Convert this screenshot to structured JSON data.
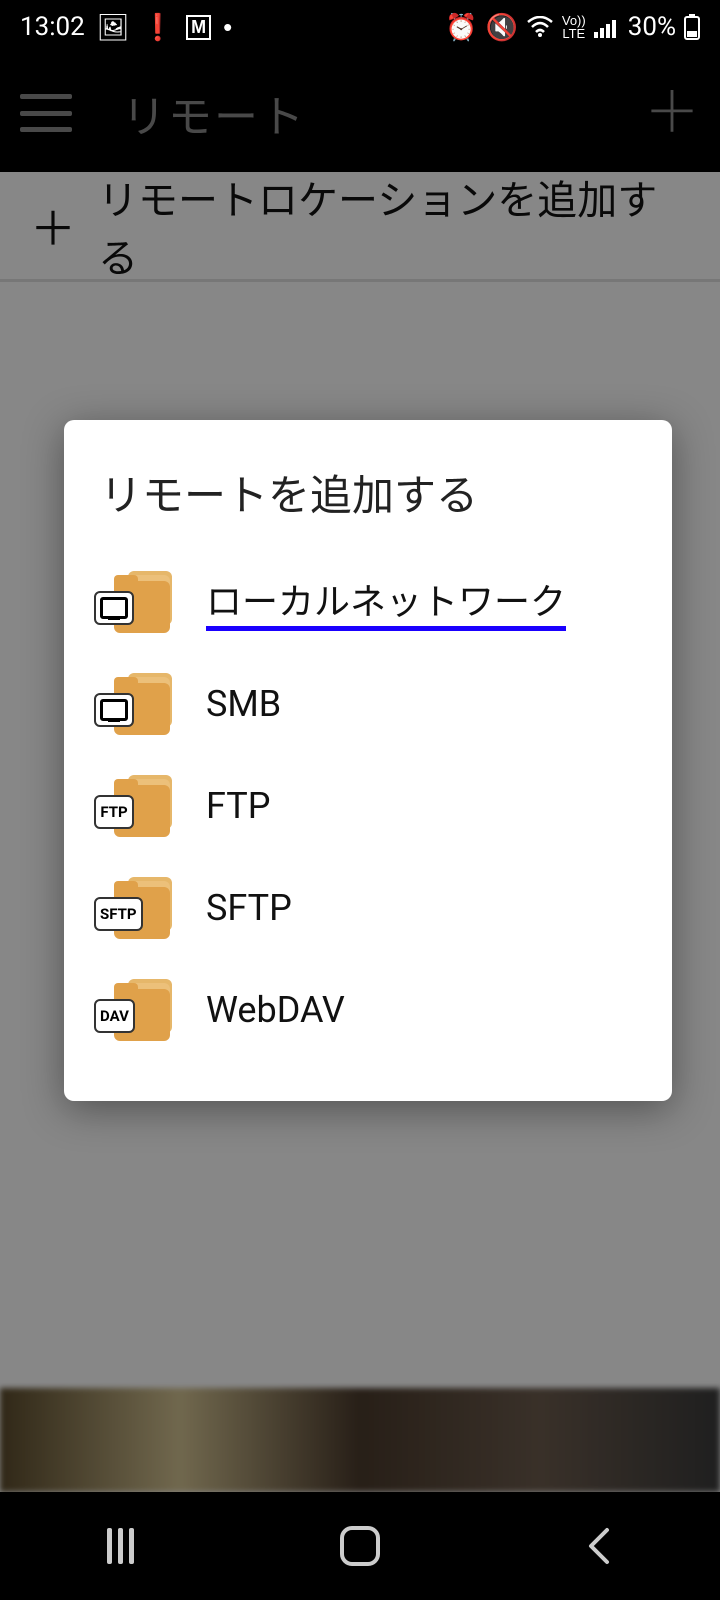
{
  "status": {
    "time": "13:02",
    "battery_pct": "30%",
    "lte_label": "Vo))\nLTE"
  },
  "header": {
    "title": "リモート"
  },
  "page": {
    "add_location_label": "リモートロケーションを追加する"
  },
  "dialog": {
    "title": "リモートを追加する",
    "items": [
      {
        "label": "ローカルネットワーク",
        "badge": "monitor",
        "highlight": true
      },
      {
        "label": "SMB",
        "badge": "monitor"
      },
      {
        "label": "FTP",
        "badge": "FTP"
      },
      {
        "label": "SFTP",
        "badge": "SFTP"
      },
      {
        "label": "WebDAV",
        "badge": "DAV"
      }
    ]
  }
}
